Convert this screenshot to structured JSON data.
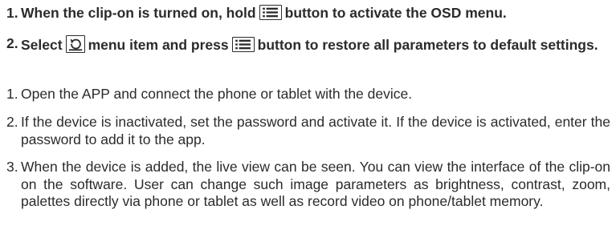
{
  "osd": {
    "step1": {
      "num": "1.",
      "before": "When the clip-on is turned on, hold",
      "after": "button to activate the OSD menu."
    },
    "step2": {
      "num": "2.",
      "select": "Select",
      "mid": "menu item and press",
      "after": "button to restore all parameters to default settings."
    },
    "icons": {
      "menu": "menu-icon",
      "restore": "restore-icon"
    }
  },
  "app": [
    {
      "num": "1.",
      "text": "Open the APP and connect the phone or tablet with the device."
    },
    {
      "num": "2.",
      "text": "If the device is inactivated, set the password and activate it. If the device is activated, enter the password to add it to the app."
    },
    {
      "num": "3.",
      "text": "When the device is added, the live view can be seen. You can view the interface of the clip-on on the software. User can change such image parameters as brightness, contrast, zoom, palettes directly via phone or tablet as well as record video on phone/tablet memory."
    }
  ]
}
